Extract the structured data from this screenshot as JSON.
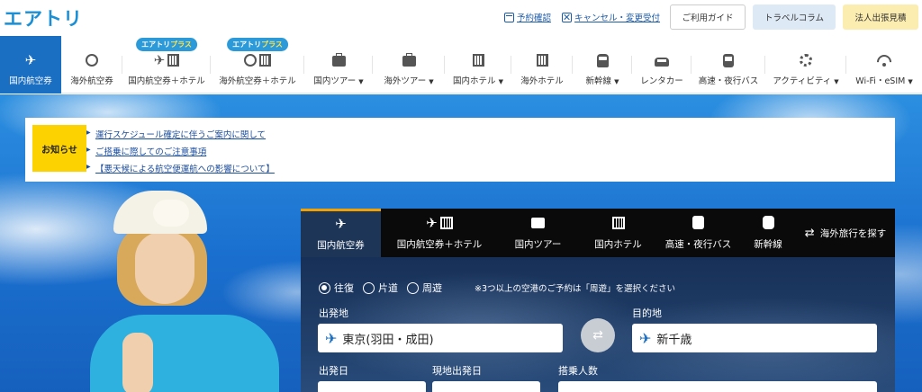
{
  "header": {
    "logo": "エアトリ",
    "util_links": [
      {
        "label": "予約確認",
        "icon": "calendar-icon"
      },
      {
        "label": "キャンセル・変更受付",
        "icon": "cancel-icon"
      }
    ],
    "buttons": [
      "ご利用ガイド",
      "トラベルコラム",
      "法人出張見積"
    ]
  },
  "nav": {
    "items": [
      {
        "label": "国内航空券",
        "icon": "airplane-icon",
        "active": true
      },
      {
        "label": "海外航空券",
        "icon": "globe-plane-icon"
      },
      {
        "label": "国内航空券＋ホテル",
        "icon": "plane-hotel-icon",
        "badge": "エアトリプラス"
      },
      {
        "label": "海外航空券＋ホテル",
        "icon": "globe-hotel-icon",
        "badge": "エアトリプラス"
      },
      {
        "label": "国内ツアー",
        "icon": "suitcase-icon",
        "caret": true
      },
      {
        "label": "海外ツアー",
        "icon": "suitcase-icon",
        "caret": true
      },
      {
        "label": "国内ホテル",
        "icon": "building-icon",
        "caret": true
      },
      {
        "label": "海外ホテル",
        "icon": "building-icon"
      },
      {
        "label": "新幹線",
        "icon": "train-icon",
        "caret": true
      },
      {
        "label": "レンタカー",
        "icon": "car-icon"
      },
      {
        "label": "高速・夜行バス",
        "icon": "bus-icon"
      },
      {
        "label": "アクティビティ",
        "icon": "activity-icon",
        "caret": true
      },
      {
        "label": "Wi-Fi・eSIM",
        "icon": "wifi-icon",
        "caret": true
      }
    ]
  },
  "notice": {
    "label": "お知らせ",
    "links": [
      "運行スケジュール確定に伴うご案内に関して",
      "ご搭乗に際してのご注意事項",
      "【悪天候による航空便運航への影響について】"
    ]
  },
  "search": {
    "tabs": [
      {
        "label": "国内航空券",
        "active": true
      },
      {
        "label": "国内航空券＋ホテル"
      },
      {
        "label": "国内ツアー"
      },
      {
        "label": "国内ホテル"
      },
      {
        "label": "高速・夜行バス"
      },
      {
        "label": "新幹線"
      }
    ],
    "abroad": "海外旅行を探す",
    "trip_types": [
      {
        "label": "往復",
        "checked": true
      },
      {
        "label": "片道"
      },
      {
        "label": "周遊"
      }
    ],
    "note": "※3つ以上の空港のご予約は「周遊」を選択ください",
    "origin_label": "出発地",
    "origin_value": "東京(羽田・成田)",
    "destination_label": "目的地",
    "destination_value": "新千歳",
    "depart_date_label": "出発日",
    "local_date_label": "現地出発日",
    "passengers_label": "搭乗人数"
  }
}
